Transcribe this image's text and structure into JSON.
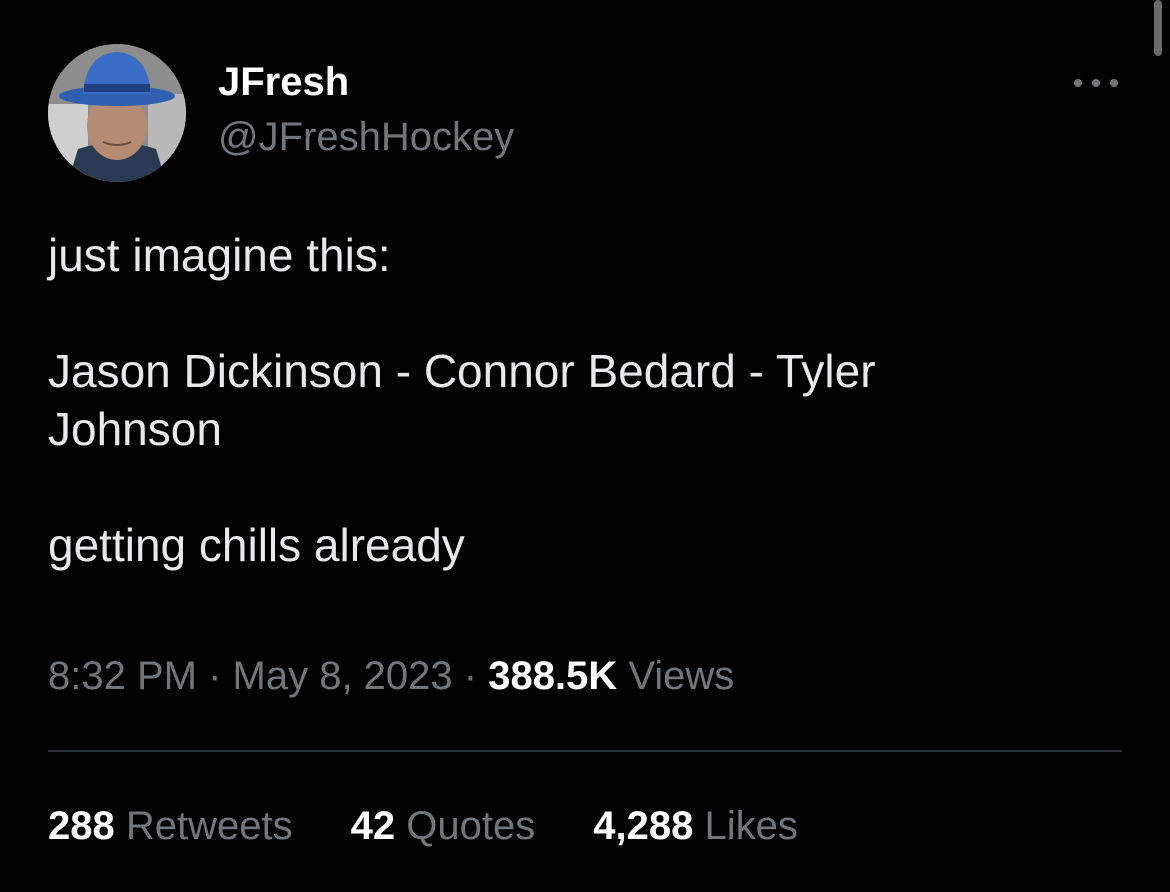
{
  "author": {
    "name": "JFresh",
    "handle": "@JFreshHockey",
    "avatar_icon": "profile-photo-blue-hat"
  },
  "more_icon": "more-horizontal-icon",
  "tweet": {
    "line1": "just imagine this:",
    "line2": "Jason Dickinson - Connor Bedard - Tyler Johnson",
    "line3": "getting chills already"
  },
  "meta": {
    "time": "8:32 PM",
    "separator": " · ",
    "date": "May 8, 2023",
    "views_count": "388.5K",
    "views_label": "Views"
  },
  "stats": {
    "retweets_count": "288",
    "retweets_label": "Retweets",
    "quotes_count": "42",
    "quotes_label": "Quotes",
    "likes_count": "4,288",
    "likes_label": "Likes"
  },
  "colors": {
    "background": "#000000",
    "primary_text": "#e7e9ea",
    "secondary_text": "#71767b",
    "divider": "#2f3336"
  }
}
